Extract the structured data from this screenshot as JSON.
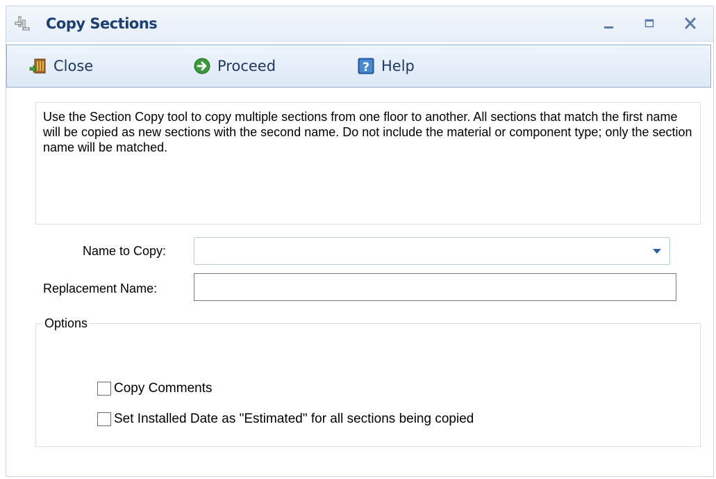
{
  "window": {
    "title": "Copy Sections",
    "controls": {
      "minimize": "minimize",
      "maximize": "maximize",
      "close": "close"
    }
  },
  "toolbar": {
    "close_label": "Close",
    "proceed_label": "Proceed",
    "help_label": "Help"
  },
  "description": "Use the Section Copy tool to copy multiple sections from one floor to another.  All sections that match the first name will be copied as new sections with the second name. Do not include the material or component type; only the section name will be matched.",
  "form": {
    "name_to_copy_label": "Name to Copy:",
    "name_to_copy_value": "",
    "replacement_name_label": "Replacement Name:",
    "replacement_name_value": ""
  },
  "options": {
    "legend": "Options",
    "copy_comments_label": "Copy Comments",
    "copy_comments_checked": false,
    "estimated_date_label": "Set Installed Date as \"Estimated\" for all sections being copied",
    "estimated_date_checked": false
  },
  "icons": {
    "title": "copy-sections-icon",
    "close": "exit-door-icon",
    "proceed": "arrow-right-circle-icon",
    "help": "help-icon"
  },
  "colors": {
    "title_text": "#1b3f73",
    "toolbar_text": "#1d3963",
    "proceed_green": "#3a9a3a",
    "help_blue": "#2f6db5"
  }
}
